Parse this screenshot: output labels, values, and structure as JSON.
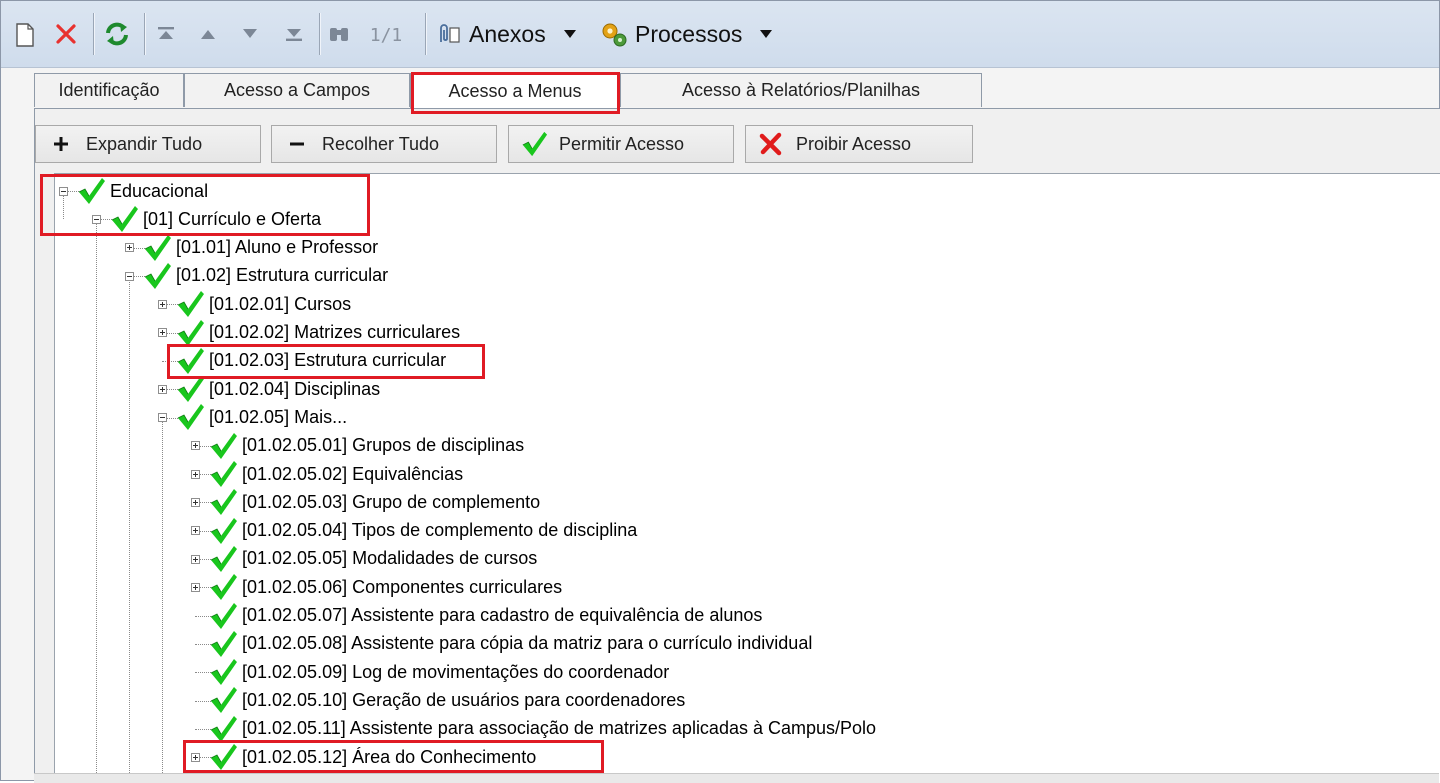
{
  "toolbar": {
    "count": "1/1",
    "attachments_label": "Anexos",
    "processes_label": "Processos",
    "icons": [
      "new-document-icon",
      "delete-icon",
      "refresh-icon",
      "first-record-icon",
      "previous-record-icon",
      "next-record-icon",
      "last-record-icon",
      "binoculars-icon",
      "paperclip-icon",
      "gears-icon"
    ]
  },
  "tabs": [
    {
      "label": "Identificação",
      "active": false
    },
    {
      "label": "Acesso a Campos",
      "active": false
    },
    {
      "label": "Acesso a Menus",
      "active": true
    },
    {
      "label": "Acesso à Relatórios/Planilhas",
      "active": false
    }
  ],
  "buttons": {
    "expand_all": "Expandir Tudo",
    "collapse_all": "Recolher Tudo",
    "allow_access": "Permitir Acesso",
    "deny_access": "Proibir Acesso"
  },
  "tree": {
    "items": [
      {
        "label": "Educacional",
        "level": 0,
        "expander": "minus"
      },
      {
        "label": "[01] Currículo e Oferta",
        "level": 1,
        "expander": "minus"
      },
      {
        "label": "[01.01] Aluno e Professor",
        "level": 2,
        "expander": "plus"
      },
      {
        "label": "[01.02] Estrutura curricular",
        "level": 2,
        "expander": "minus"
      },
      {
        "label": "[01.02.01] Cursos",
        "level": 3,
        "expander": "plus"
      },
      {
        "label": "[01.02.02] Matrizes curriculares",
        "level": 3,
        "expander": "plus"
      },
      {
        "label": "[01.02.03] Estrutura curricular",
        "level": 3,
        "expander": "none"
      },
      {
        "label": "[01.02.04] Disciplinas",
        "level": 3,
        "expander": "plus"
      },
      {
        "label": "[01.02.05] Mais...",
        "level": 3,
        "expander": "minus"
      },
      {
        "label": "[01.02.05.01] Grupos de disciplinas",
        "level": 4,
        "expander": "plus"
      },
      {
        "label": "[01.02.05.02] Equivalências",
        "level": 4,
        "expander": "plus"
      },
      {
        "label": "[01.02.05.03] Grupo de complemento",
        "level": 4,
        "expander": "plus"
      },
      {
        "label": "[01.02.05.04] Tipos de complemento de disciplina",
        "level": 4,
        "expander": "plus"
      },
      {
        "label": "[01.02.05.05] Modalidades de cursos",
        "level": 4,
        "expander": "plus"
      },
      {
        "label": "[01.02.05.06] Componentes curriculares",
        "level": 4,
        "expander": "plus"
      },
      {
        "label": "[01.02.05.07] Assistente para cadastro de equivalência de alunos",
        "level": 4,
        "expander": "none"
      },
      {
        "label": "[01.02.05.08] Assistente para cópia da matriz para o currículo individual",
        "level": 4,
        "expander": "none"
      },
      {
        "label": "[01.02.05.09] Log de movimentações do coordenador",
        "level": 4,
        "expander": "none"
      },
      {
        "label": "[01.02.05.10] Geração de usuários para coordenadores",
        "level": 4,
        "expander": "none"
      },
      {
        "label": "[01.02.05.11] Assistente para associação de matrizes aplicadas à Campus/Polo",
        "level": 4,
        "expander": "none"
      },
      {
        "label": "[01.02.05.12] Área do Conhecimento",
        "level": 4,
        "expander": "plus"
      }
    ]
  },
  "colors": {
    "check_green": "#19c61d",
    "highlight_red": "#e01b24",
    "toolbar_bg": "#d6e1ee"
  }
}
